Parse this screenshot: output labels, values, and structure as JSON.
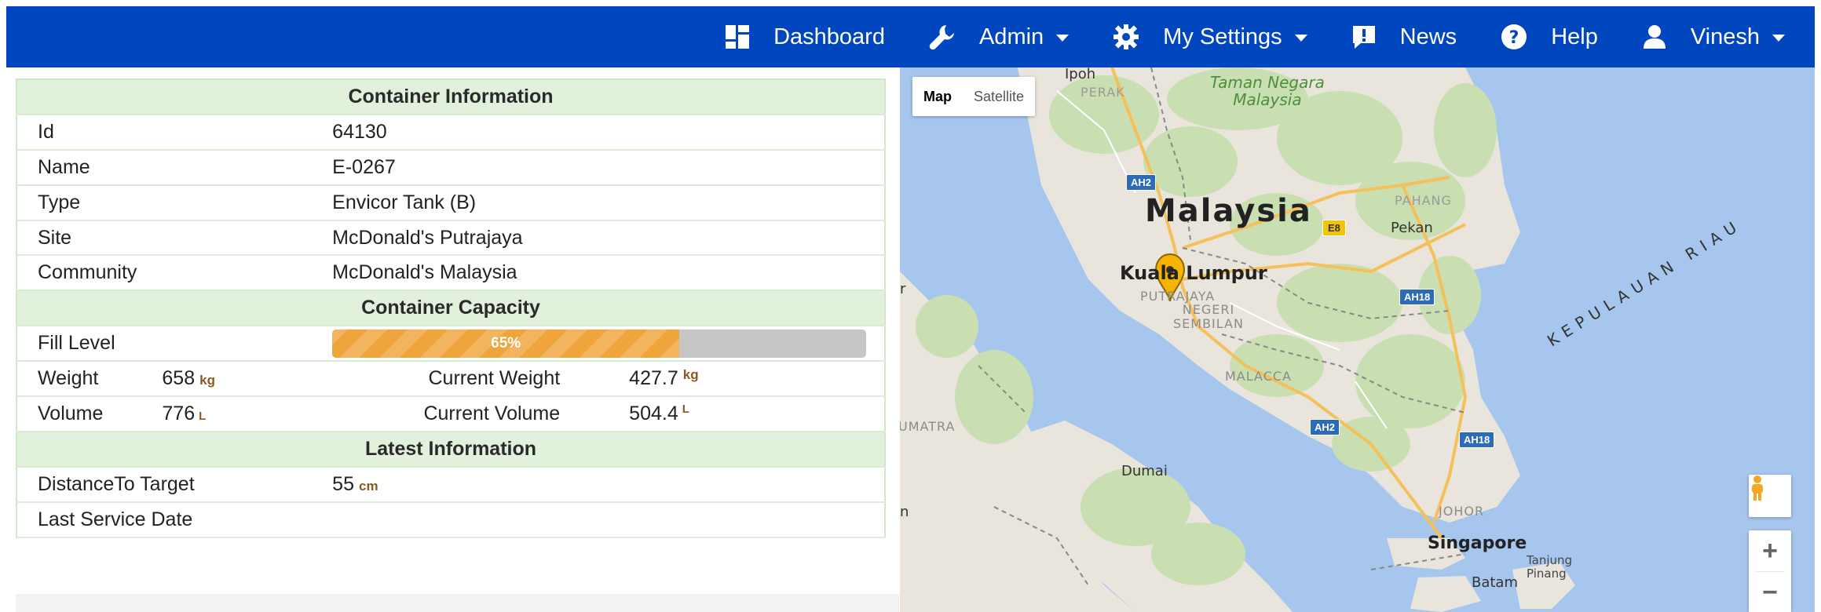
{
  "nav": {
    "dashboard": "Dashboard",
    "admin": "Admin",
    "settings": "My Settings",
    "news": "News",
    "help": "Help",
    "user": "Vinesh"
  },
  "container_info": {
    "heading": "Container Information",
    "rows": [
      {
        "label": "Id",
        "value": "64130"
      },
      {
        "label": "Name",
        "value": "E-0267"
      },
      {
        "label": "Type",
        "value": "Envicor Tank (B)"
      },
      {
        "label": "Site",
        "value": "McDonald's Putrajaya"
      },
      {
        "label": "Community",
        "value": "McDonald's Malaysia"
      }
    ]
  },
  "capacity": {
    "heading": "Container Capacity",
    "fill_label": "Fill Level",
    "fill_percent": 65,
    "fill_text": "65%",
    "weight_label": "Weight",
    "weight_value": "658",
    "weight_unit": "kg",
    "current_weight_label": "Current Weight",
    "current_weight_value": "427.7",
    "current_weight_unit": "kg",
    "volume_label": "Volume",
    "volume_value": "776",
    "volume_unit": "L",
    "current_volume_label": "Current Volume",
    "current_volume_value": "504.4",
    "current_volume_unit": "L"
  },
  "latest": {
    "heading": "Latest Information",
    "distance_label": "DistanceTo Target",
    "distance_value": "55",
    "distance_unit": "cm",
    "service_label": "Last Service Date",
    "service_value": ""
  },
  "map": {
    "type_map": "Map",
    "type_satellite": "Satellite",
    "labels": {
      "malaysia": "Malaysia",
      "taman_negara": "Taman Negara\nMalaysia",
      "ipoh": "Ipoh",
      "perak": "PERAK",
      "pahang": "PAHANG",
      "pekan": "Pekan",
      "kuala_lumpur": "Kuala Lumpur",
      "putrajaya": "PUTRAJAYA",
      "negeri": "NEGERI\nSEMBILAN",
      "malacca": "MALACCA",
      "sumatra": "UMATRA",
      "dumai": "Dumai",
      "johor": "JOHOR",
      "singapore": "Singapore",
      "tanjung": "Tanjung\nPinang",
      "batam": "Batam",
      "kepulauan": "KEPULAUAN RIAU",
      "edge_r": "r",
      "edge_n": "n"
    },
    "highways": [
      "AH2",
      "E8",
      "AH18",
      "AH18",
      "AH2",
      "AH18"
    ],
    "zoom_in": "+",
    "zoom_out": "−"
  }
}
